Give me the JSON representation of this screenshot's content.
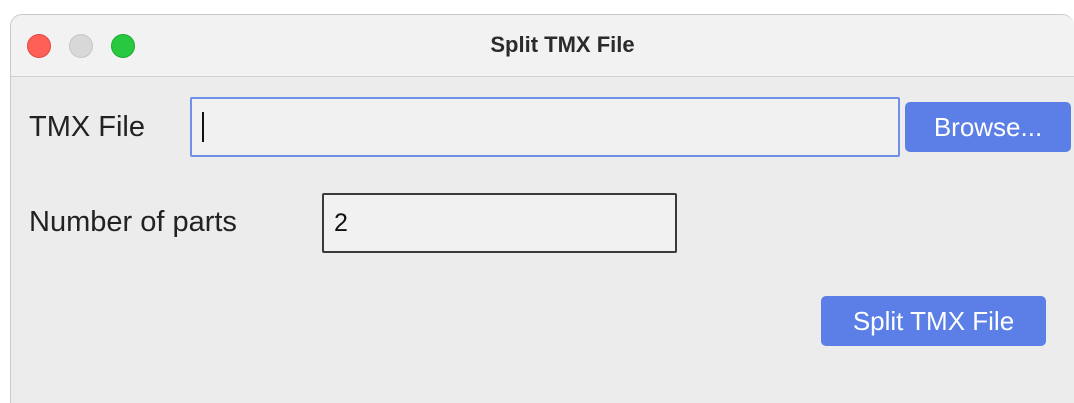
{
  "window": {
    "title": "Split TMX File"
  },
  "colors": {
    "accent": "#5b7fe6",
    "close": "#fe5f57",
    "minimize": "#d9d8d8",
    "maximize": "#28c840"
  },
  "form": {
    "tmx_file_label": "TMX File",
    "tmx_file_value": "",
    "browse_label": "Browse...",
    "parts_label": "Number of parts",
    "parts_value": "2",
    "split_label": "Split TMX File"
  }
}
